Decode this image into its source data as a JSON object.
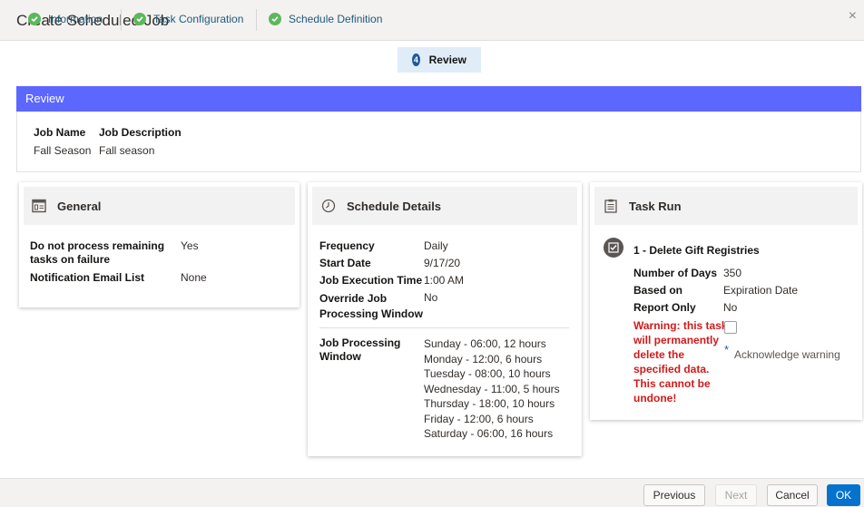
{
  "dialog": {
    "title": "Create Scheduled Job",
    "close_glyph": "×"
  },
  "tabs": [
    {
      "label": "Information",
      "state": "complete"
    },
    {
      "label": "Task Configuration",
      "state": "complete"
    },
    {
      "label": "Schedule Definition",
      "state": "complete"
    },
    {
      "label": "Review",
      "state": "active",
      "number": "4"
    }
  ],
  "review": {
    "header": "Review",
    "columns": [
      "Job Name",
      "Job Description"
    ],
    "values": [
      "Fall Season",
      "Fall season"
    ]
  },
  "general": {
    "title": "General",
    "icon": "general-panel-icon",
    "rows": [
      {
        "label": "Do not process remaining tasks on failure",
        "label_line1": "Do not process remaining",
        "label_line2": "tasks on failure",
        "value": "Yes"
      },
      {
        "label": "Notification Email List",
        "value": "None"
      }
    ]
  },
  "schedule": {
    "title": "Schedule Details",
    "icon": "clock-icon",
    "rows": [
      {
        "label": "Frequency",
        "value": "Daily"
      },
      {
        "label": "Start Date",
        "value": "9/17/20"
      },
      {
        "label": "Job Execution Time",
        "value": "1:00 AM"
      },
      {
        "label": "Override Job Processing Window",
        "label_line1": "Override Job",
        "label_line2": "Processing Window",
        "value": "No"
      }
    ],
    "window_label_line1": "Job Processing",
    "window_label_line2": "Window",
    "window_values": [
      "Sunday - 06:00, 12 hours",
      "Monday - 12:00, 6 hours",
      "Tuesday - 08:00, 10 hours",
      "Wednesday - 11:00, 5 hours",
      "Thursday - 18:00, 10 hours",
      "Friday - 12:00, 6 hours",
      "Saturday - 06:00, 16 hours"
    ]
  },
  "task_run": {
    "title": "Task Run",
    "icon": "clipboard-icon",
    "task_title": "1 - Delete Gift Registries",
    "rows": [
      {
        "label": "Number of Days",
        "value": "350"
      },
      {
        "label": "Based on",
        "value": "Expiration Date"
      },
      {
        "label": "Report Only",
        "value": "No"
      }
    ],
    "warning_lines": [
      "Warning: this task",
      "will permanently",
      "delete the",
      "specified data.",
      "This cannot be",
      "undone!"
    ],
    "required_mark": "*",
    "acknowledge_label": "Acknowledge warning"
  },
  "footer": {
    "previous": "Previous",
    "next": "Next",
    "cancel": "Cancel",
    "ok": "OK"
  },
  "colors": {
    "review_bar": "#5c67ff",
    "primary": "#0572ce",
    "complete": "#5cb85c",
    "warning": "#d21a1a"
  }
}
